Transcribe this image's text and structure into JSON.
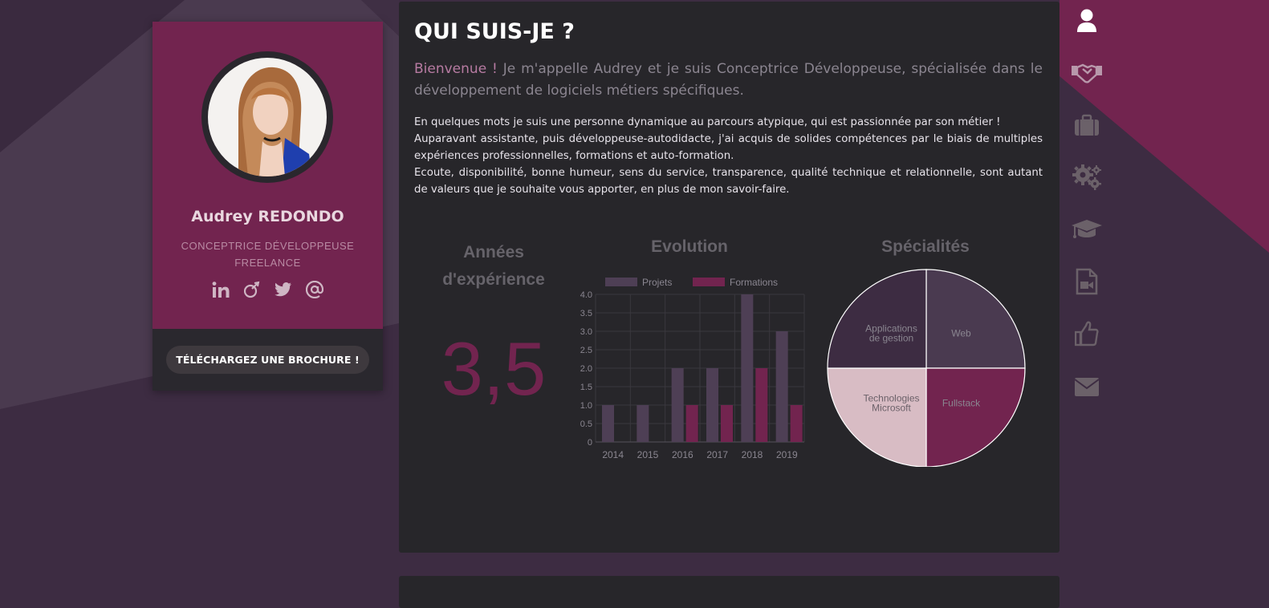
{
  "colors": {
    "background": "#3d2c42",
    "accent": "#72244f",
    "panel": "#27262a",
    "muted_text": "#8b8590",
    "highlight": "#b77ba2"
  },
  "profile": {
    "name": "Audrey REDONDO",
    "role_line1": "CONCEPTRICE DÉVELOPPEUSE",
    "role_line2": "FREELANCE",
    "social_icons": [
      "linkedin-icon",
      "malt-icon",
      "twitter-icon",
      "email-at-icon"
    ],
    "brochure_button": "TÉLÉCHARGEZ UNE BROCHURE !"
  },
  "about": {
    "title": "QUI SUIS-JE ?",
    "lead_highlight": "Bienvenue !",
    "lead_rest": " Je m'appelle Audrey et je suis Conceptrice Développeuse, spécialisée dans le développement de logiciels métiers spécifiques.",
    "paragraphs": [
      "En quelques mots je suis une personne dynamique au parcours atypique, qui est passionnée par son métier !",
      "Auparavant assistante, puis développeuse-autodidacte, j'ai acquis de solides compétences par le biais de multiples expériences professionnelles, formations et auto-formation.",
      "Ecoute, disponibilité, bonne humeur, sens du service, transparence, qualité technique et relationnelle, sont autant de valeurs que je souhaite vous apporter, en plus de mon savoir-faire."
    ]
  },
  "stats": {
    "experience_title_line1": "Années",
    "experience_title_line2": "d'expérience",
    "experience_value": "3,5"
  },
  "chart_data": [
    {
      "type": "bar",
      "title": "Evolution",
      "categories": [
        "2014",
        "2015",
        "2016",
        "2017",
        "2018",
        "2019"
      ],
      "series": [
        {
          "name": "Projets",
          "values": [
            1,
            1,
            2,
            2,
            4,
            3
          ],
          "color": "#4e3f55"
        },
        {
          "name": "Formations",
          "values": [
            0,
            0,
            1,
            1,
            2,
            1
          ],
          "color": "#72244f"
        }
      ],
      "ylim": [
        0,
        4
      ],
      "yticks": [
        "0",
        "0.5",
        "1.0",
        "1.5",
        "2.0",
        "2.5",
        "3.0",
        "3.5",
        "4.0"
      ],
      "legend": "top",
      "grid": true
    },
    {
      "type": "pie",
      "title": "Spécialités",
      "slices": [
        {
          "label": "Web",
          "value": 25,
          "color": "#4a3a50"
        },
        {
          "label": "Fullstack",
          "value": 25,
          "color": "#72244f"
        },
        {
          "label": "Technologies Microsoft",
          "value": 25,
          "color": "#d8bcc4"
        },
        {
          "label": "Applications de gestion",
          "value": 25,
          "color": "#3d2c42"
        }
      ]
    }
  ],
  "nav": {
    "items": [
      "user-icon",
      "handshake-icon",
      "briefcase-icon",
      "gears-icon",
      "graduation-cap-icon",
      "video-file-icon",
      "thumbs-up-icon",
      "envelope-icon"
    ]
  }
}
